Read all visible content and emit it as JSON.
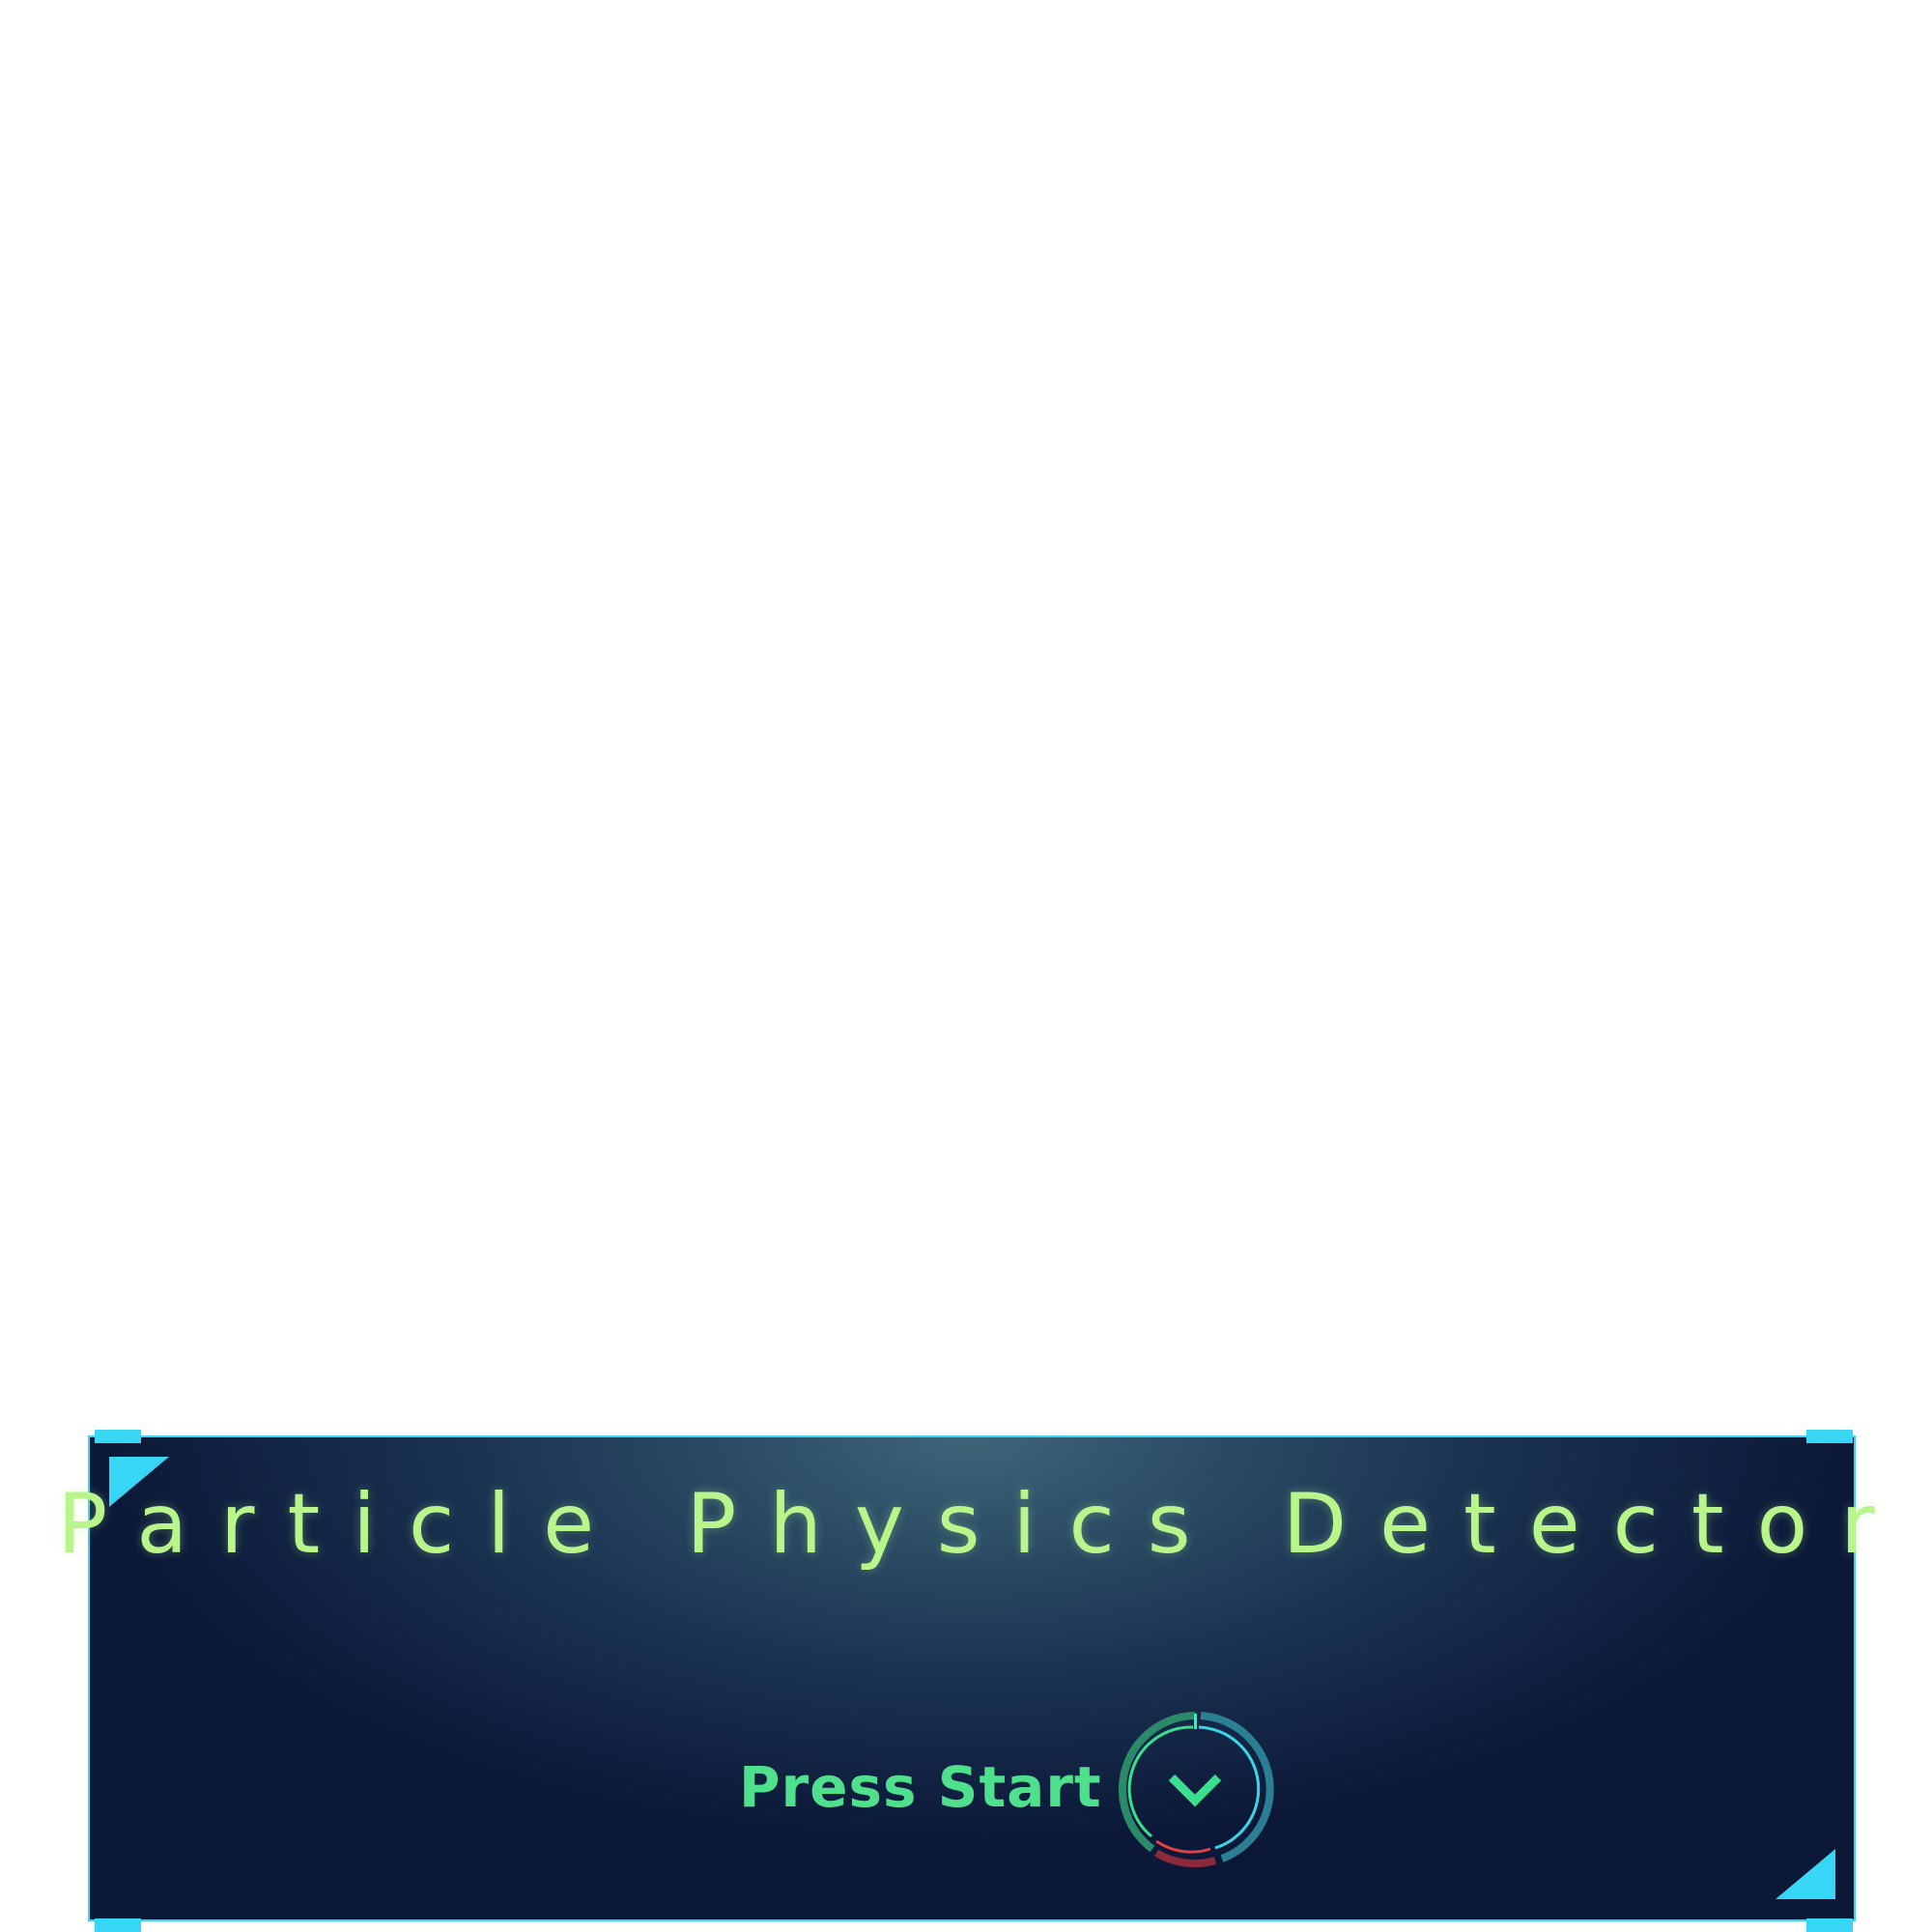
{
  "game": {
    "title": "Particle Physics Detector",
    "prompt": "Press Start"
  },
  "icons": {
    "start_button": "chevron-down-icon",
    "corner_top_left": "corner-triangle-icon",
    "corner_bottom_right": "corner-triangle-icon"
  },
  "colors": {
    "accent": "#38d6f5",
    "title": "#b8f58a",
    "prompt": "#4fe08e",
    "ring_green": "#3ae08e",
    "ring_teal": "#38c8d8",
    "ring_red": "#e04048",
    "panel_dark": "#0c1838"
  }
}
